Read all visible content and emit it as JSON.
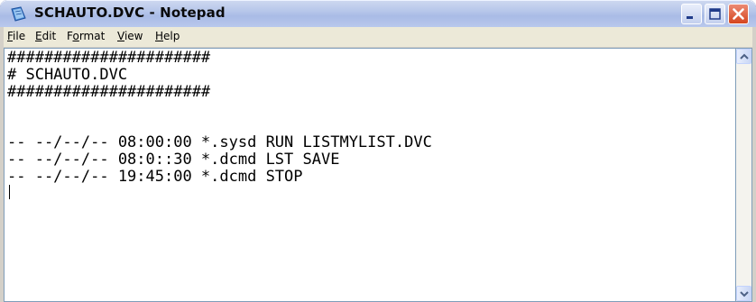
{
  "window": {
    "title": "SCHAUTO.DVC - Notepad",
    "icon": "notepad-icon"
  },
  "menu": {
    "file": {
      "mn": "F",
      "rest": "ile"
    },
    "edit": {
      "mn": "E",
      "rest": "dit"
    },
    "format": {
      "pre": "F",
      "mn": "o",
      "rest": "rmat"
    },
    "view": {
      "mn": "V",
      "rest": "iew"
    },
    "help": {
      "mn": "H",
      "rest": "elp"
    }
  },
  "document": {
    "lines": [
      "######################",
      "# SCHAUTO.DVC",
      "######################",
      "",
      "-- --/--/-- 08:00:00 *.sysd RUN LISTMYLIST.DVC",
      "-- --/--/-- 08:0::30 *.dcmd LST SAVE",
      "-- --/--/-- 19:45:00 *.dcmd STOP"
    ]
  },
  "colors": {
    "titlebar": "#b7c7ea",
    "close_button": "#d5461f",
    "menubar": "#ece9d8",
    "editor_border": "#7f9db9"
  }
}
